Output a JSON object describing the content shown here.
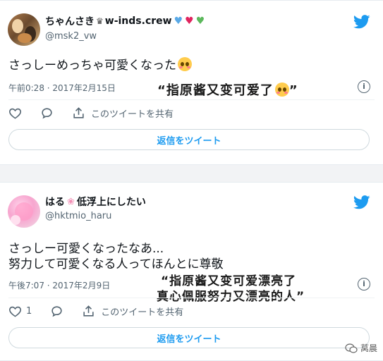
{
  "tweet1": {
    "display_name": "ちゃんさき",
    "name_suffix": "w-inds.crew",
    "handle": "@msk2_vw",
    "text": "さっしーめっちゃ可愛くなった",
    "timestamp": "午前0:28 · 2017年2月15日",
    "caption": "“指原酱又变可爱了",
    "caption_end": "”",
    "share_label": "このツイートを共有",
    "reply_label": "返信をツイート",
    "heart_colors": [
      "#5aa9e6",
      "#e0245e",
      "#5cb85c"
    ]
  },
  "tweet2": {
    "display_name_a": "はる",
    "display_name_b": "低浮上にしたい",
    "handle": "@hktmio_haru",
    "text_line1": "さっしー可愛くなったなあ...",
    "text_line2": "努力して可愛くなる人ってほんとに尊敬",
    "timestamp": "午後7:07 · 2017年2月9日",
    "caption_line1": "“指原酱又变可爱漂亮了",
    "caption_line2": "真心佩服努力又漂亮的人”",
    "like_count": "1",
    "share_label": "このツイートを共有",
    "reply_label": "返信をツイート"
  },
  "watermark": "莴晨",
  "colors": {
    "twitter_blue": "#1d9bf0",
    "muted": "#536471",
    "border": "#cfd9de"
  },
  "icons": [
    "twitter-bird-icon",
    "heart-outline-icon",
    "reply-icon",
    "share-icon",
    "info-icon",
    "crown-icon",
    "sakura-icon",
    "flushed-face-icon",
    "wechat-icon"
  ]
}
